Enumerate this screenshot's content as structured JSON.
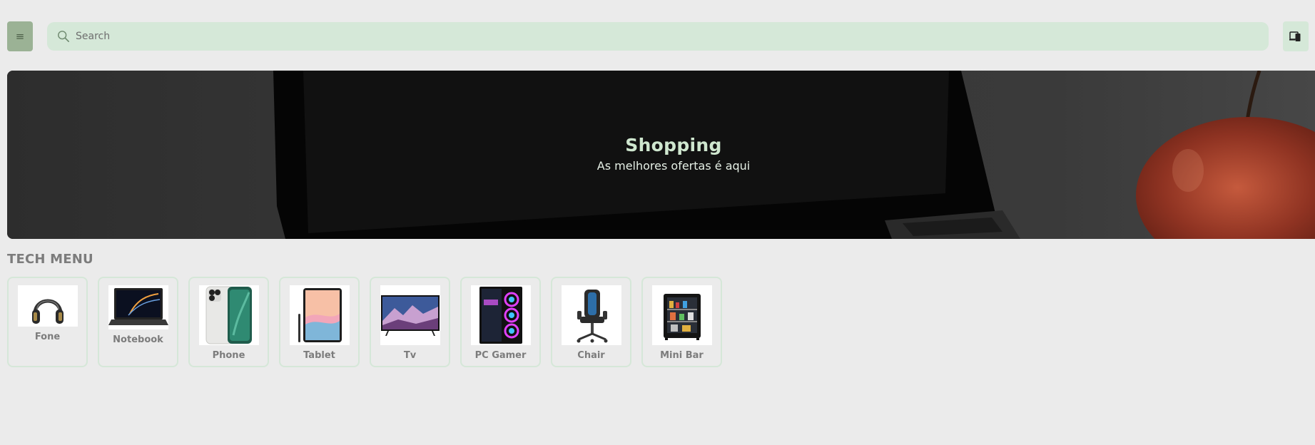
{
  "header": {
    "menu_icon": "hamburger-icon",
    "search_placeholder": "Search",
    "search_value": "",
    "search_icon": "search-icon",
    "device_icon": "devices-icon"
  },
  "hero": {
    "title": "Shopping",
    "subtitle": "As melhores ofertas é aqui"
  },
  "section": {
    "title": "TECH MENU"
  },
  "categories": [
    {
      "label": "Fone",
      "icon": "headphones-image"
    },
    {
      "label": "Notebook",
      "icon": "laptop-image"
    },
    {
      "label": "Phone",
      "icon": "smartphone-image"
    },
    {
      "label": "Tablet",
      "icon": "tablet-image"
    },
    {
      "label": "Tv",
      "icon": "tv-image"
    },
    {
      "label": "PC Gamer",
      "icon": "gaming-pc-image"
    },
    {
      "label": "Chair",
      "icon": "gaming-chair-image"
    },
    {
      "label": "Mini Bar",
      "icon": "mini-fridge-image"
    }
  ],
  "colors": {
    "page_bg": "#ebebeb",
    "accent_green": "#9bb295",
    "search_bg": "#d5e8d8",
    "hero_title": "#cfe7cf",
    "label_gray": "#7c7c7c"
  }
}
